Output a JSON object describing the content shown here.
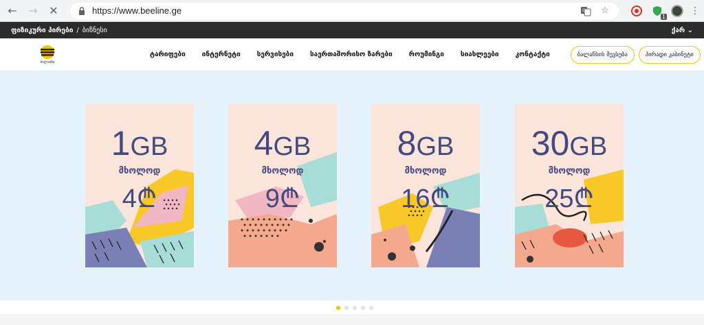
{
  "browser": {
    "url": "https://www.beeline.ge",
    "extension_badge": "1"
  },
  "topbar": {
    "personal": "ფიზიკური პირები",
    "separator": "/",
    "business": "ბიზნესი",
    "language": "ქარ"
  },
  "header": {
    "logo_text": "ბილაინი",
    "menu": [
      "ტარიფები",
      "ინტერნეტი",
      "სერვისები",
      "საერთაშორისო ზარები",
      "როუმინგი",
      "სიახლეები",
      "კონტაქტი"
    ],
    "balance_button": "ბალანსის შევსება",
    "cabinet_button": "პირადი კაბინეტი"
  },
  "cards": [
    {
      "amount": "1",
      "unit": "GB",
      "only": "მხოლოდ",
      "price": "4₾"
    },
    {
      "amount": "4",
      "unit": "GB",
      "only": "მხოლოდ",
      "price": "9₾"
    },
    {
      "amount": "8",
      "unit": "GB",
      "only": "მხოლოდ",
      "price": "16₾"
    },
    {
      "amount": "30",
      "unit": "GB",
      "only": "მხოლოდ",
      "price": "25₾"
    }
  ],
  "colors": {
    "accent": "#f5c400",
    "card_bg": "#fbe5db",
    "text": "#444a80",
    "hero_bg": "#e6f2fb"
  }
}
